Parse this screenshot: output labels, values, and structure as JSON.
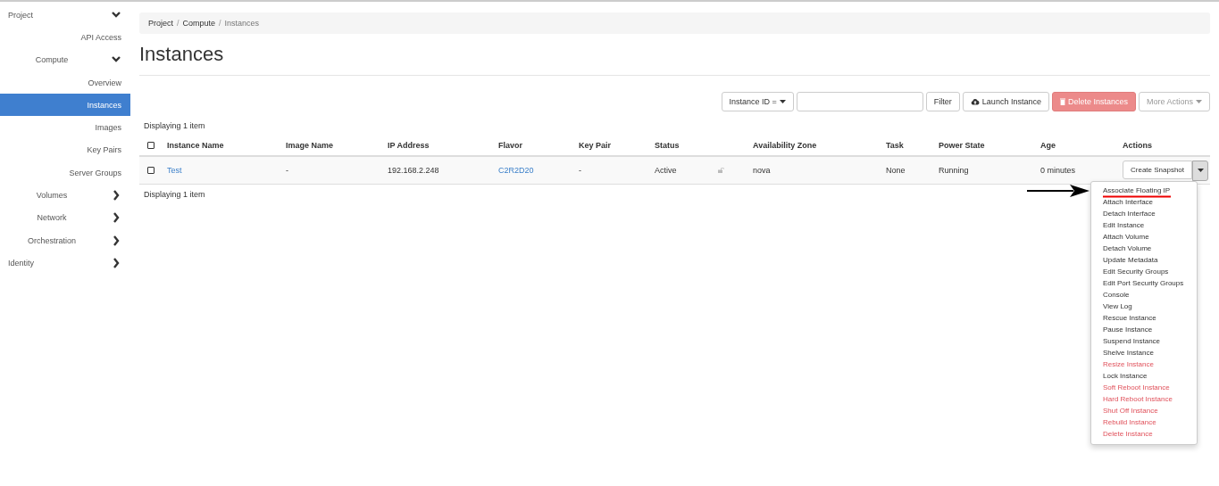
{
  "sidebar": {
    "items": [
      {
        "label": "Project",
        "kind": "section",
        "expanded": true,
        "children": [
          {
            "label": "API Access",
            "kind": "link",
            "selected": false
          },
          {
            "label": "Compute",
            "kind": "group",
            "expanded": true,
            "children": [
              {
                "label": "Overview",
                "kind": "link",
                "selected": false
              },
              {
                "label": "Instances",
                "kind": "link",
                "selected": true
              },
              {
                "label": "Images",
                "kind": "link",
                "selected": false
              },
              {
                "label": "Key Pairs",
                "kind": "link",
                "selected": false
              },
              {
                "label": "Server Groups",
                "kind": "link",
                "selected": false
              }
            ]
          },
          {
            "label": "Volumes",
            "kind": "group",
            "expanded": false
          },
          {
            "label": "Network",
            "kind": "group",
            "expanded": false
          },
          {
            "label": "Orchestration",
            "kind": "group",
            "expanded": false
          }
        ]
      },
      {
        "label": "Identity",
        "kind": "section",
        "expanded": false
      }
    ]
  },
  "breadcrumb": [
    {
      "label": "Project",
      "separator": "/"
    },
    {
      "label": "Compute",
      "separator": "/"
    },
    {
      "label": "Instances"
    }
  ],
  "page_title": "Instances",
  "toolbar": {
    "filter_select": "Instance ID =",
    "filter_button": "Filter",
    "launch_button": "Launch Instance",
    "delete_button": "Delete Instances",
    "more_button": "More Actions"
  },
  "table": {
    "count_top": "Displaying 1 item",
    "select_all_checked": false,
    "columns": [
      "Instance Name",
      "Image Name",
      "IP Address",
      "Flavor",
      "Key Pair",
      "Status",
      "",
      "Availability Zone",
      "Task",
      "Power State",
      "Age",
      "Actions"
    ],
    "rows": [
      {
        "checked": false,
        "cells": [
          "Test",
          "-",
          "192.168.2.248",
          "C2R2D20",
          "-",
          "Active",
          "",
          "nova",
          "None",
          "Running",
          "0 minutes"
        ],
        "action": "Create Snapshot"
      }
    ],
    "count_bottom": "Displaying 1 item"
  },
  "action_menu": {
    "items": [
      {
        "label": "Associate Floating IP",
        "kind": "normal"
      },
      {
        "label": "Attach Interface",
        "kind": "normal"
      },
      {
        "label": "Detach Interface",
        "kind": "normal"
      },
      {
        "label": "Edit Instance",
        "kind": "normal"
      },
      {
        "label": "Attach Volume",
        "kind": "normal"
      },
      {
        "label": "Detach Volume",
        "kind": "normal"
      },
      {
        "label": "Update Metadata",
        "kind": "normal"
      },
      {
        "label": "Edit Security Groups",
        "kind": "normal"
      },
      {
        "label": "Edit Port Security Groups",
        "kind": "normal"
      },
      {
        "label": "Console",
        "kind": "normal"
      },
      {
        "label": "View Log",
        "kind": "normal"
      },
      {
        "label": "Rescue Instance",
        "kind": "normal"
      },
      {
        "label": "Pause Instance",
        "kind": "normal"
      },
      {
        "label": "Suspend Instance",
        "kind": "normal"
      },
      {
        "label": "Shelve Instance",
        "kind": "normal"
      },
      {
        "label": "Resize Instance",
        "kind": "danger"
      },
      {
        "label": "Lock Instance",
        "kind": "normal"
      },
      {
        "label": "Soft Reboot Instance",
        "kind": "danger"
      },
      {
        "label": "Hard Reboot Instance",
        "kind": "danger"
      },
      {
        "label": "Shut Off Instance",
        "kind": "danger"
      },
      {
        "label": "Rebuild Instance",
        "kind": "danger"
      },
      {
        "label": "Delete Instance",
        "kind": "danger"
      }
    ]
  }
}
